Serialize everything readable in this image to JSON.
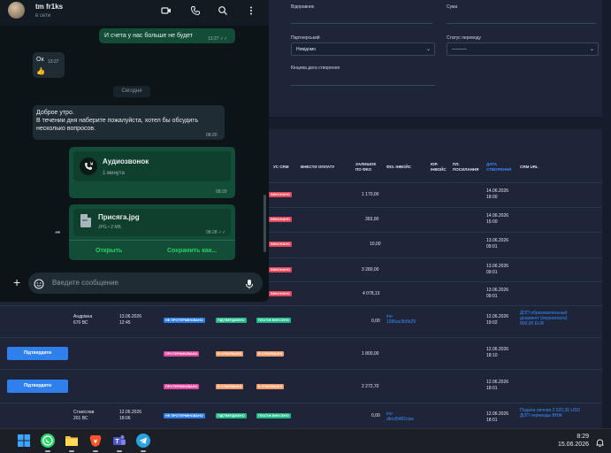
{
  "chat": {
    "contact_name": "tm fr1ks",
    "status": "в сети",
    "messages": [
      {
        "text": "И счета у нас больше не будет",
        "time": "13:27"
      },
      {
        "text": "Ок",
        "time": "13:27",
        "emoji": "👍"
      },
      {
        "date_separator": "Сегодня"
      },
      {
        "text_lines": [
          "Доброе утро.",
          "В течении дня наберите пожалуйста, хотел бы обсудить",
          "несколько вопросов."
        ],
        "time": "08:20"
      },
      {
        "call_title": "Аудиозвонок",
        "call_duration": "1 минута",
        "time": "08:29"
      },
      {
        "file_name": "Присяга.jpg",
        "file_meta": "JPG • 2 МБ",
        "time": "08:28",
        "open_label": "Открыть",
        "save_label": "Сохранить как..."
      }
    ],
    "composer_placeholder": "Введите сообщение"
  },
  "filters": {
    "sender_label": "Відправник",
    "sum_label": "Сума",
    "partner_label": "Партнерський",
    "partner_value": "Невідомо",
    "status_label": "Статус переводу",
    "status_value": "----------",
    "end_date_label": "Кінцева дата створення"
  },
  "table": {
    "headers": {
      "crm_status": "УС CRM",
      "pay_in": "ВНЕСТИ ОПЛАТУ",
      "amount_line1": "ЗАЛИШОК",
      "amount_line2": "ПО ФКО",
      "fiz_invoice": "ФІЗ. ІНВОЙС",
      "ur_invoice_line1": "ЮР.",
      "ur_invoice_line2": "ІНВОЙС",
      "links_line1": "ПЛ.",
      "links_line2": "ПОСИЛАННЯ",
      "created_line1": "ДАТА",
      "created_line2": "СТВОРЕННЯ",
      "crm_url": "CRM URL"
    },
    "rows": [
      {
        "amount": "1 170,00",
        "date": "14.06.2026",
        "time": "18:00",
        "badge": "ВИКОНАНО"
      },
      {
        "amount": "393,00",
        "date": "14.06.2026",
        "time": "15:00",
        "badge": "ВИКОНАНО"
      },
      {
        "amount": "10,00",
        "date": "13.06.2026",
        "time": "09:01",
        "badge": "ВИКОНАНО"
      },
      {
        "amount": "3 280,00",
        "date": "13.06.2026",
        "time": "09:01",
        "badge": "ВИКОНАНО"
      },
      {
        "amount": "4 078,13",
        "date": "13.06.2026",
        "time": "09:01",
        "badge": "ВИКОНАНО"
      },
      {
        "sender": "Андріана",
        "sender_extra": "670 ВС",
        "date_left": "13.06.2026",
        "time_left": "12:45",
        "b1": "НЕ ПРОТЕРМІНОВАНО",
        "b2": "ПІДТВЕРДЖЕНО",
        "b3": "ПЛАТІЖ ВНЕСЕНО",
        "amount": "0,00",
        "inv_line1": "inv-",
        "inv_line2": "1586ac3b5b29",
        "date": "12.06.2026",
        "time": "19:02",
        "crm_line1": "ДОП образовательный",
        "crm_line2": "документ (перeoплата)",
        "crm_line3": "800,00 EUR"
      },
      {
        "button": "Підтвердити",
        "b1": "ПРОТЕРМІНОВАНО",
        "b2": "В ОЧІКУВАННІ",
        "b3": "В ОЧІКУВАННІ",
        "amount": "1 800,00",
        "date": "12.06.2026",
        "time": "18:10"
      },
      {
        "button": "Підтвердити",
        "b1": "ПРОТЕРМІНОВАНО",
        "b2": "В ОЧІКУВАННІ",
        "b3": "В ОЧІКУВАННІ",
        "amount": "2 272,70",
        "date": "12.06.2026",
        "time": "18:01"
      },
      {
        "sender": "Станіслав",
        "sender_extra": "201 ВС",
        "date_left": "12.06.2026",
        "time_left": "18:06",
        "b1": "НЕ ПРОТЕРМІНОВАНО",
        "b2": "ПІДТВЕРДЖЕНО",
        "b3": "ПЛАТІЖ ВНЕСЕНО",
        "amount": "0,00",
        "inv_line1": "inv-",
        "inv_line2": "dbcd5482ctac",
        "date": "12.06.2026",
        "time": "18:01",
        "crm_line1": "Подача личная 2 520,36 USD",
        "crm_line2": "ДОП переводы ВНЖ"
      }
    ]
  },
  "taskbar": {
    "time": "8:29",
    "date": "15.06.2026",
    "apps": [
      "windows-start",
      "whatsapp",
      "file-explorer",
      "brave",
      "teams",
      "telegram"
    ]
  },
  "colors": {
    "whatsapp_green": "#25d366",
    "outgoing_bubble": "#134d37",
    "crm_link": "#3d8bff",
    "confirm_button": "#2f80ed"
  }
}
